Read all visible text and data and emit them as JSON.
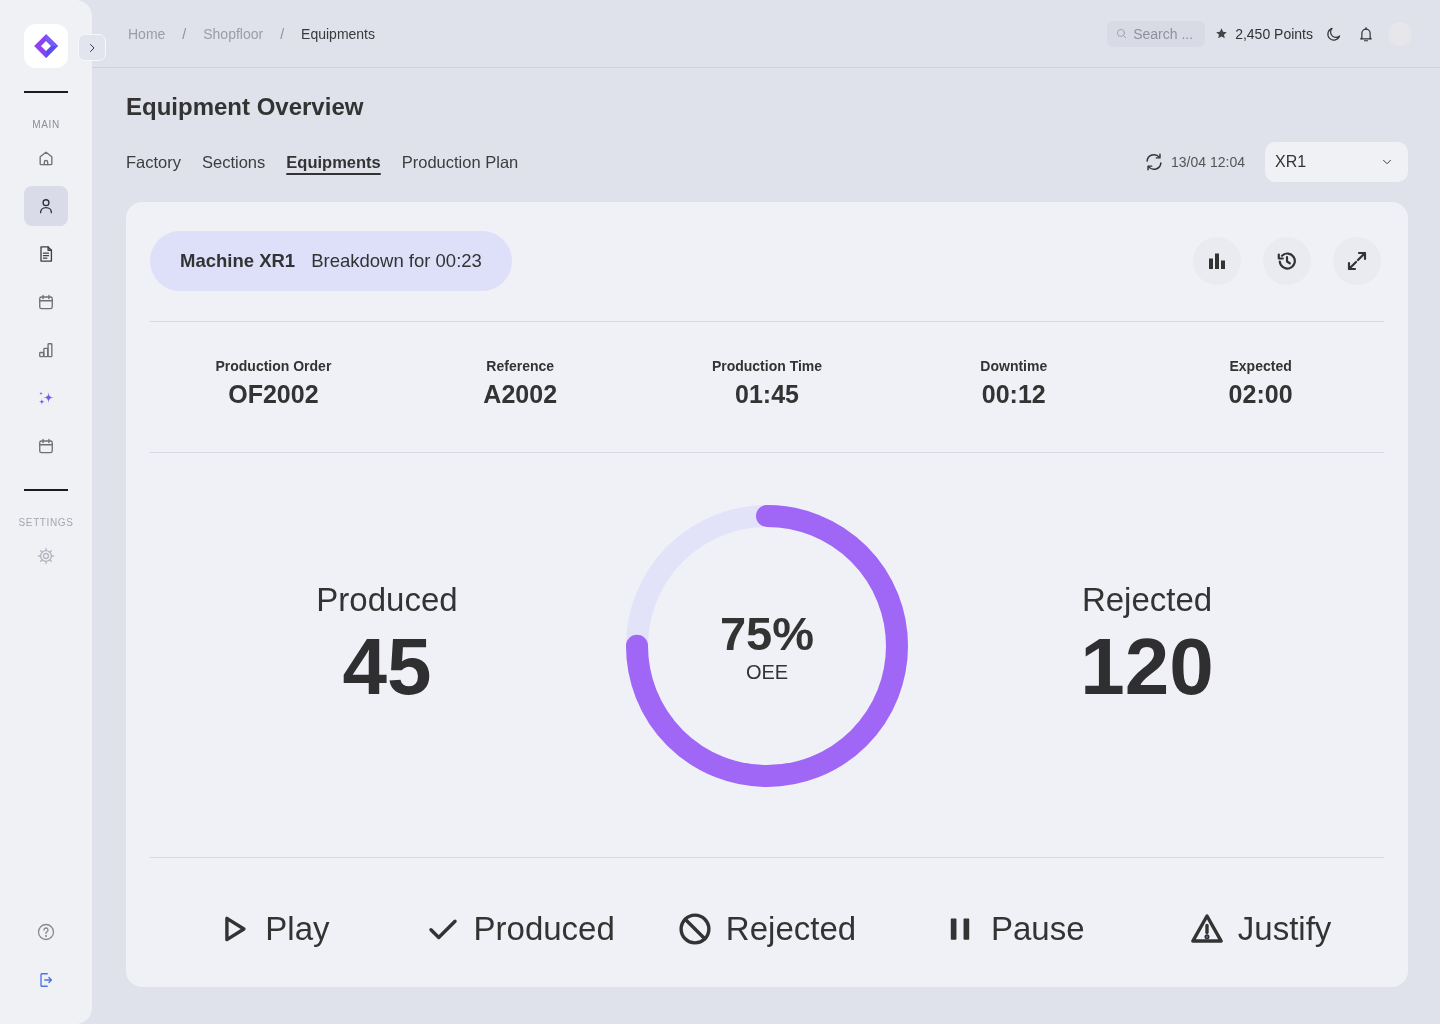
{
  "sidebar": {
    "sections": [
      {
        "label": "MAIN",
        "items": [
          {
            "selected": false
          },
          {
            "selected": true
          },
          {
            "selected": false
          },
          {
            "selected": false
          },
          {
            "selected": false
          },
          {
            "selected": false
          },
          {
            "selected": false
          }
        ]
      },
      {
        "label": "SETTINGS",
        "items": [
          {
            "selected": false
          }
        ]
      }
    ]
  },
  "topbar": {
    "breadcrumbs": [
      {
        "label": "Home",
        "current": false,
        "separator": "/"
      },
      {
        "label": "Shopfloor",
        "current": false,
        "separator": "/"
      },
      {
        "label": "Equipments",
        "current": true
      }
    ],
    "search": {
      "placeholder": "Search ..."
    },
    "points": "2,450 Points"
  },
  "page": {
    "title": "Equipment Overview",
    "tabs": [
      {
        "label": "Factory",
        "selected": false
      },
      {
        "label": "Sections",
        "selected": false
      },
      {
        "label": "Equipments",
        "selected": true
      },
      {
        "label": "Production Plan",
        "selected": false
      }
    ],
    "last_sync": "13/04 12:04",
    "machine_select": {
      "value": "XR1"
    }
  },
  "card": {
    "status": {
      "machine": "Machine XR1",
      "message": "Breakdown for 00:23"
    },
    "stats": [
      {
        "label": "Production Order",
        "value": "OF2002"
      },
      {
        "label": "Reference",
        "value": "A2002"
      },
      {
        "label": "Production Time",
        "value": "01:45"
      },
      {
        "label": "Downtime",
        "value": "00:12"
      },
      {
        "label": "Expected",
        "value": "02:00"
      }
    ],
    "produced": {
      "label": "Produced",
      "value": "45"
    },
    "oee": {
      "value": "75%",
      "label": "OEE",
      "level": 0.75
    },
    "rejected": {
      "label": "Rejected",
      "value": "120"
    },
    "actions": [
      {
        "label": "Play"
      },
      {
        "label": "Produced"
      },
      {
        "label": "Rejected"
      },
      {
        "label": "Pause"
      },
      {
        "label": "Justify"
      }
    ]
  }
}
